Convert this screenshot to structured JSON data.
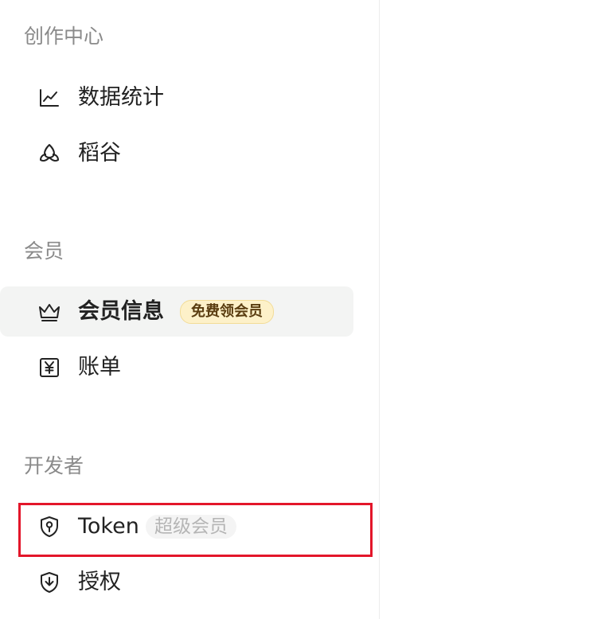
{
  "sections": {
    "creation": {
      "title": "创作中心",
      "items": [
        {
          "label": "数据统计",
          "icon": "line-chart-icon"
        },
        {
          "label": "稻谷",
          "icon": "grain-icon"
        }
      ]
    },
    "membership": {
      "title": "会员",
      "items": [
        {
          "label": "会员信息",
          "icon": "crown-icon",
          "badge": "免费领会员",
          "active": true
        },
        {
          "label": "账单",
          "icon": "yuan-bill-icon"
        }
      ]
    },
    "developer": {
      "title": "开发者",
      "items": [
        {
          "label": "Token",
          "icon": "key-shield-icon",
          "badge": "超级会员",
          "highlighted": true
        },
        {
          "label": "授权",
          "icon": "authorize-shield-icon"
        }
      ]
    }
  },
  "colors": {
    "active_bg": "#f3f4f3",
    "gold_badge_bg": "#fdf1c9",
    "highlight_border": "#e3162a"
  }
}
